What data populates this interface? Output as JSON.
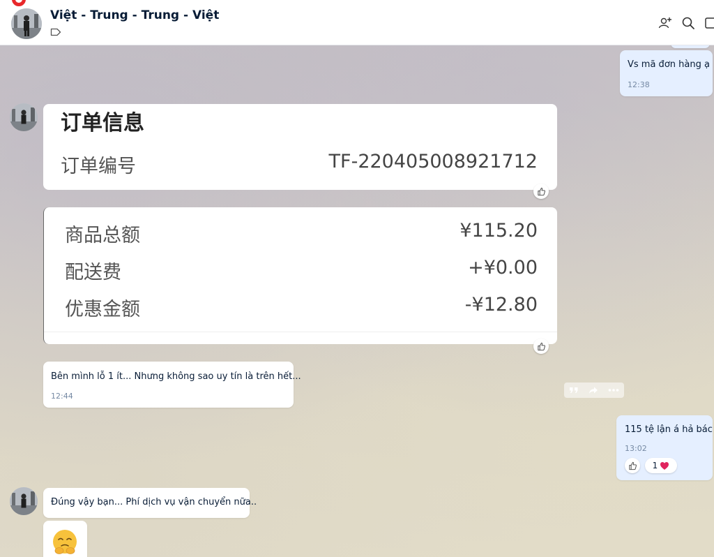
{
  "conversation": {
    "title": "Việt - Trung - Trung - Việt"
  },
  "header_icons": [
    "add-member-icon",
    "search-icon",
    "layout-icon",
    "label-tag-icon"
  ],
  "messages": {
    "m1": {
      "text": "Vs mã đơn hàng ạ",
      "time": "12:38"
    },
    "order_info": {
      "title": "订单信息",
      "label": "订单编号",
      "value": "TF-220405008921712"
    },
    "order_totals": {
      "rows": [
        {
          "label": "商品总额",
          "value": "¥115.20"
        },
        {
          "label": "配送费",
          "value": "+¥0.00"
        },
        {
          "label": "优惠金额",
          "value": "-¥12.80"
        }
      ]
    },
    "m2": {
      "text": "Bên mình lỗ 1 ít... Nhưng không sao uy tín là trên hết...",
      "time": "12:44"
    },
    "m3": {
      "text": "115 tệ lận á hả bác",
      "time": "13:02",
      "reaction_count": "1"
    },
    "m4": {
      "text": "Đúng vậy bạn... Phí dịch vụ vận chuyển nữa.."
    }
  },
  "colors": {
    "accent_red": "#e8282b",
    "my_bubble": "#e5efff",
    "heart": "#e0245e",
    "time_text": "#7589a3"
  }
}
